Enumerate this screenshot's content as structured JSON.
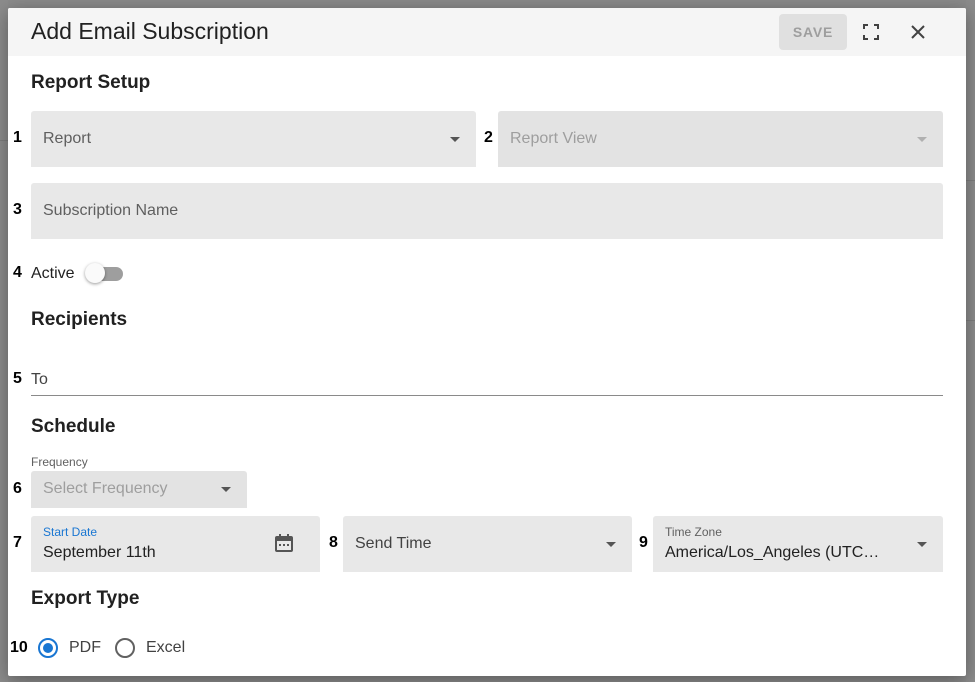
{
  "dialog": {
    "title": "Add Email Subscription",
    "save_label": "SAVE",
    "icons": {
      "fullscreen": "fullscreen-icon",
      "close": "close-icon"
    }
  },
  "sections": {
    "report_setup": "Report Setup",
    "recipients": "Recipients",
    "schedule": "Schedule",
    "export_type": "Export Type"
  },
  "numbers": [
    "1",
    "2",
    "3",
    "4",
    "5",
    "6",
    "7",
    "8",
    "9",
    "10"
  ],
  "report_setup": {
    "report": {
      "label": "Report"
    },
    "report_view": {
      "label": "Report View",
      "disabled": true
    },
    "subscription_name": {
      "placeholder": "Subscription Name"
    },
    "active": {
      "label": "Active",
      "on": false
    }
  },
  "recipients": {
    "to": {
      "label": "To"
    }
  },
  "schedule": {
    "frequency": {
      "caption": "Frequency",
      "placeholder": "Select Frequency",
      "disabled": true
    },
    "start_date": {
      "label": "Start Date",
      "value": "September 11th",
      "icon": "calendar-icon"
    },
    "send_time": {
      "label": "Send Time"
    },
    "time_zone": {
      "label": "Time Zone",
      "value": "America/Los_Angeles (UTC…"
    }
  },
  "export_type": {
    "options": [
      {
        "label": "PDF",
        "checked": true
      },
      {
        "label": "Excel",
        "checked": false
      }
    ]
  },
  "colors": {
    "accent": "#1976d2",
    "field_bg": "#e8e8e8",
    "header_bg": "#f5f5f5",
    "overlay": "#8a8a8a"
  }
}
